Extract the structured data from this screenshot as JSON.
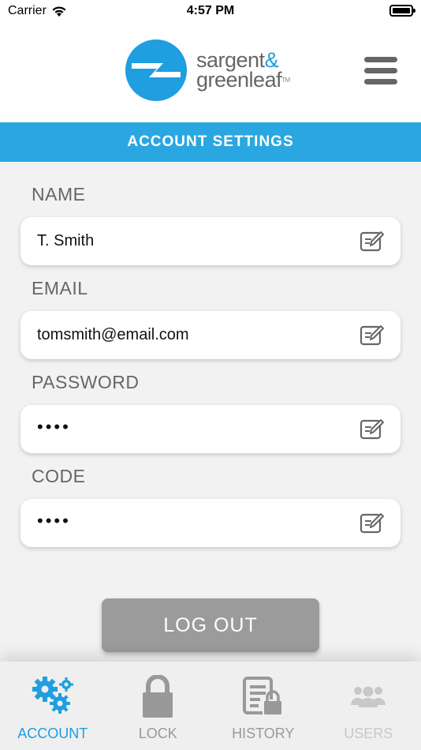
{
  "status": {
    "carrier": "Carrier",
    "time": "4:57 PM"
  },
  "header": {
    "logo_line1": "sargent",
    "logo_amp": "&",
    "logo_line2": "greenleaf",
    "logo_tm": "TM",
    "brand_color": "#1f9ee0"
  },
  "page": {
    "title": "ACCOUNT  SETTINGS",
    "accent_color": "#2aa7e0"
  },
  "fields": [
    {
      "label": "NAME",
      "value": "T. Smith",
      "icon": "edit-icon"
    },
    {
      "label": "EMAIL",
      "value": "tomsmith@email.com",
      "icon": "edit-icon"
    },
    {
      "label": "PASSWORD",
      "value": "••••",
      "icon": "edit-icon"
    },
    {
      "label": "CODE",
      "value": "••••",
      "icon": "edit-icon"
    }
  ],
  "logout_label": "LOG OUT",
  "tabs": [
    {
      "label": "ACCOUNT",
      "icon": "gears-icon",
      "state": "active"
    },
    {
      "label": "LOCK",
      "icon": "lock-icon",
      "state": "inactive"
    },
    {
      "label": "HISTORY",
      "icon": "history-icon",
      "state": "inactive"
    },
    {
      "label": "USERS",
      "icon": "users-icon",
      "state": "disabled"
    }
  ]
}
